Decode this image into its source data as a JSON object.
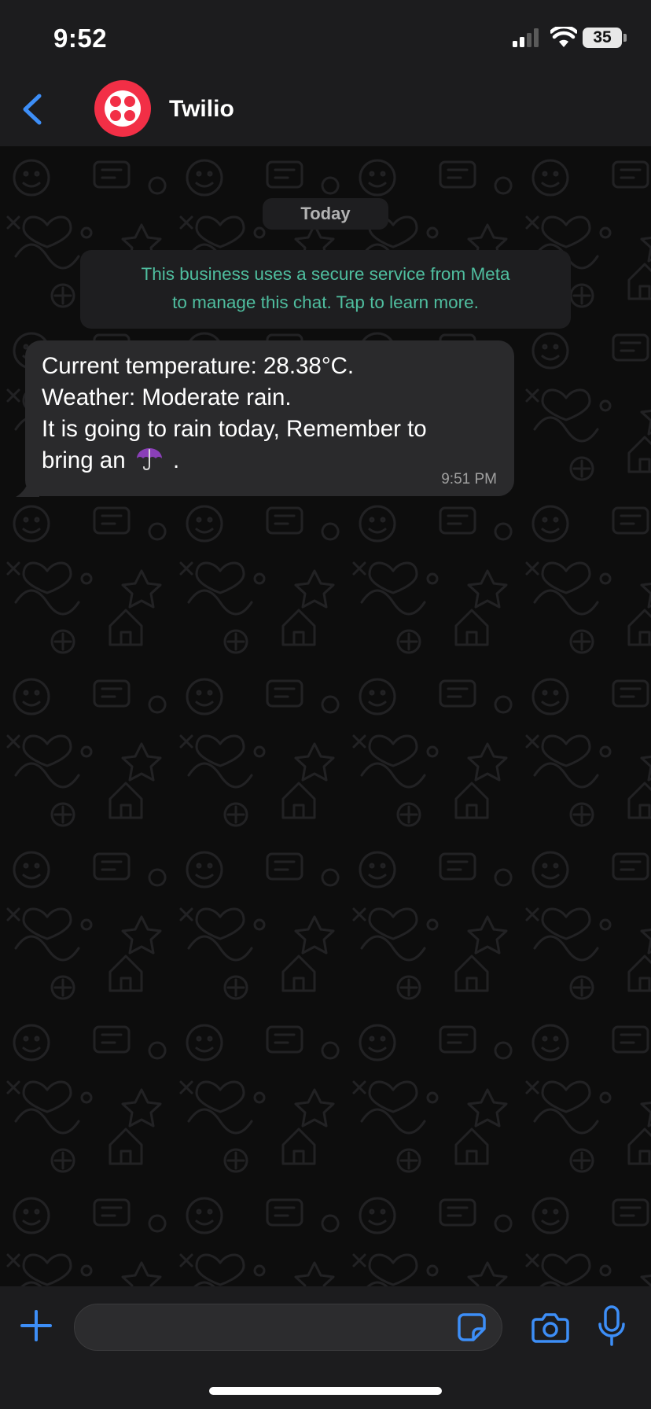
{
  "status_bar": {
    "time": "9:52",
    "battery": "35"
  },
  "header": {
    "contact_name": "Twilio"
  },
  "chat": {
    "date_label": "Today",
    "notice_line1": "This business uses a secure service from Meta",
    "notice_line2": "to manage this chat. Tap to learn more.",
    "message": {
      "line1": "Current temperature: 28.38°C.",
      "line2": "Weather: Moderate rain.",
      "line3": "It is going to rain today, Remember to",
      "line4_before_emoji": "bring an",
      "line4_after_emoji": ".",
      "time": "9:51 PM",
      "emoji_icon": "umbrella-icon"
    }
  },
  "input_bar": {
    "placeholder": ""
  },
  "colors": {
    "accent": "#3d8ef7",
    "notice_text": "#4fbe9f",
    "bubble": "#2a2a2c",
    "avatar": "#f22f46"
  }
}
